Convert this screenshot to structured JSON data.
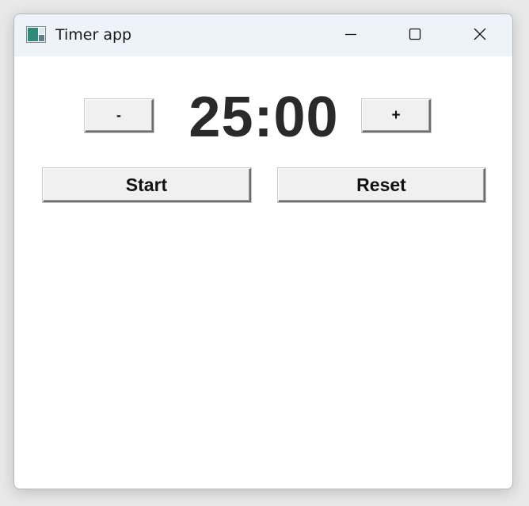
{
  "window": {
    "title": "Timer app",
    "controls": {
      "minimize_icon": "minimize-icon",
      "maximize_icon": "maximize-icon",
      "close_icon": "close-icon"
    }
  },
  "timer": {
    "display": "25:00",
    "decrement_label": "-",
    "increment_label": "+"
  },
  "actions": {
    "start_label": "Start",
    "reset_label": "Reset"
  },
  "colors": {
    "titlebar": "#eef2f9",
    "button_face": "#f0f0f0",
    "time_text": "#2a2a2a"
  }
}
